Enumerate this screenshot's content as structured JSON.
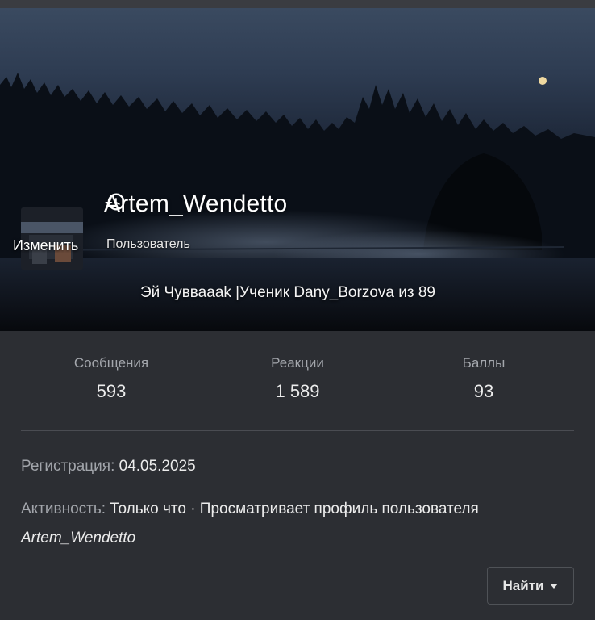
{
  "profile": {
    "username": "Artem_Wendetto",
    "user_title": "Пользователь",
    "status_text": "Эй Чувваaak |Ученик Dany_Borzova из 89",
    "avatar_edit_label": "Изменить"
  },
  "stats": [
    {
      "label": "Сообщения",
      "value": "593"
    },
    {
      "label": "Реакции",
      "value": "1 589"
    },
    {
      "label": "Баллы",
      "value": "93"
    }
  ],
  "info": {
    "registration_label": "Регистрация:",
    "registration_value": "04.05.2025",
    "activity_label": "Активность:",
    "activity_value": "Только что · Просматривает профиль пользователя",
    "activity_user": "Artem_Wendetto"
  },
  "actions": {
    "find_label": "Найти"
  },
  "icons": {
    "history": "history-icon",
    "caret": "caret-down-icon"
  },
  "colors": {
    "page_background": "#2c2e33",
    "muted_text": "#a4a7ad",
    "primary_text": "#ececec"
  }
}
